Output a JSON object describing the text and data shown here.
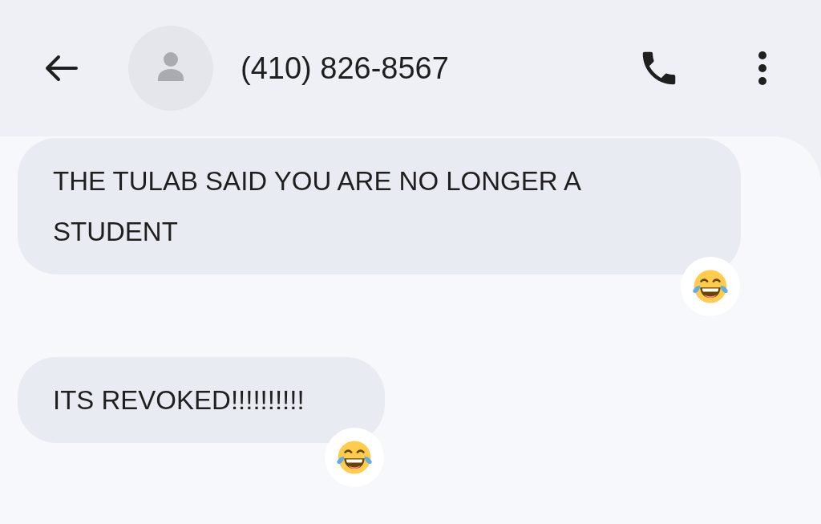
{
  "header": {
    "contact": "(410) 826-8567"
  },
  "messages": [
    {
      "text": "THE TULAB SAID YOU ARE NO LONGER A STUDENT",
      "reaction": {
        "kind": "laugh"
      }
    },
    {
      "text": "ITS REVOKED!!!!!!!!!!",
      "reaction": {
        "kind": "laugh"
      }
    }
  ]
}
